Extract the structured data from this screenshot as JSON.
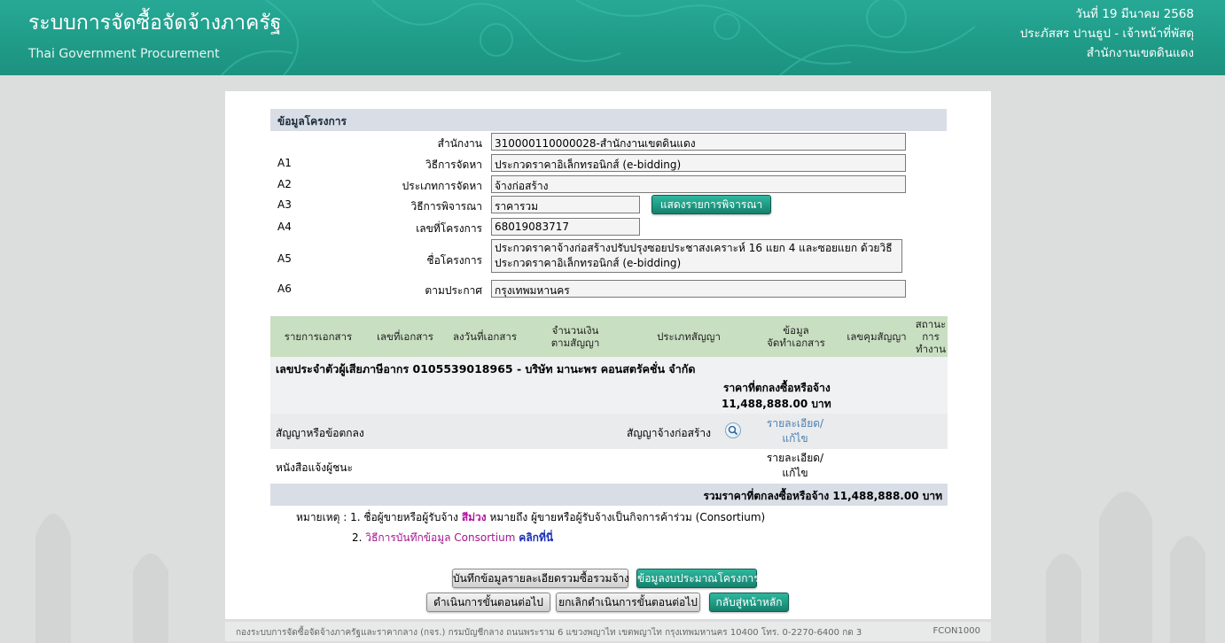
{
  "header": {
    "title": "ระบบการจัดซื้อจัดจ้างภาครัฐ",
    "subtitle": "Thai Government Procurement",
    "date": "วันที่ 19 มีนาคม 2568",
    "user": "ประภัสสร ปานธูป - เจ้าหน้าที่พัสดุ",
    "office": "สำนักงานเขตดินแดง"
  },
  "project": {
    "section_title": "ข้อมูลโครงการ",
    "rows": [
      {
        "code": "",
        "label": "สำนักงาน",
        "value": "310000110000028-สำนักงานเขตดินแดง"
      },
      {
        "code": "A1",
        "label": "วิธีการจัดหา",
        "value": "ประกวดราคาอิเล็กทรอนิกส์ (e-bidding)"
      },
      {
        "code": "A2",
        "label": "ประเภทการจัดหา",
        "value": "จ้างก่อสร้าง"
      },
      {
        "code": "A3",
        "label": "วิธีการพิจารณา",
        "value": "ราคารวม"
      },
      {
        "code": "A4",
        "label": "เลขที่โครงการ",
        "value": "68019083717"
      },
      {
        "code": "A5",
        "label": "ชื่อโครงการ",
        "value": "ประกวดราคาจ้างก่อสร้างปรับปรุงซอยประชาสงเคราะห์ 16 แยก 4 และซอยแยก ด้วยวิธีประกวดราคาอิเล็กทรอนิกส์ (e-bidding)"
      },
      {
        "code": "A6",
        "label": "ตามประกาศ",
        "value": "กรุงเทพมหานคร"
      }
    ],
    "show_items_button": "แสดงรายการพิจารณา"
  },
  "table": {
    "headers": {
      "doc_list": "รายการเอกสาร",
      "doc_no": "เลขที่เอกสาร",
      "doc_date": "ลงวันที่เอกสาร",
      "amount_1": "จำนวนเงิน",
      "amount_2": "ตามสัญญา",
      "contract_type": "ประเภทสัญญา",
      "info_1": "ข้อมูล",
      "info_2": "จัดทำเอกสาร",
      "control_no": "เลขคุมสัญญา",
      "status_1": "สถานะ",
      "status_2": "การ",
      "status_3": "ทำงาน"
    },
    "vendor": "เลขประจำตัวผู้เสียภาษีอากร 0105539018965 - บริษัท มานะพร คอนสตรัคชั่น จำกัด",
    "price_label": "ราคาที่ตกลงซื้อหรือจ้าง",
    "price_value": "11,488,888.00 บาท",
    "docs": [
      {
        "name": "สัญญาหรือข้อตกลง",
        "type": "สัญญาจ้างก่อสร้าง",
        "link_1": "รายละเอียด/",
        "link_2": "แก้ไข"
      },
      {
        "name": "หนังสือแจ้งผู้ชนะ",
        "type": "",
        "link_1": "รายละเอียด/",
        "link_2": "แก้ไข"
      }
    ],
    "total": "รวมราคาที่ตกลงซื้อหรือจ้าง 11,488,888.00 บาท"
  },
  "notes": {
    "prefix": "หมายเหตุ : 1. ชื่อผู้ขายหรือผู้รับจ้าง",
    "purple_word": "สีม่วง",
    "note1_rest": "หมายถึง ผู้ขายหรือผู้รับจ้างเป็นกิจการค้าร่วม (Consortium)",
    "note2_num": "2.",
    "note2_text": "วิธีการบันทึกข้อมูล Consortium",
    "note2_link": "คลิกที่นี่"
  },
  "buttons": {
    "save_detail": "บันทึกข้อมูลรายละเอียดรวมซื้อรวมจ้าง",
    "budget_info": "ข้อมูลงบประมาณโครงการ",
    "next_step": "ดำเนินการขั้นตอนต่อไป",
    "cancel_next": "ยกเลิกดำเนินการขั้นตอนต่อไป",
    "home": "กลับสู่หน้าหลัก"
  },
  "footer": {
    "left": "กองระบบการจัดซื้อจัดจ้างภาครัฐและราคากลาง (กจร.) กรมบัญชีกลาง ถนนพระราม 6 แขวงพญาไท เขตพญาไท กรุงเทพมหานคร 10400 โทร. 0-2270-6400 กด 3",
    "right": "FCON1000"
  },
  "colors": {
    "header_teal": "#1f9b88",
    "table_head_green": "#c9dfc1",
    "section_gray_blue": "#d8dde6",
    "button_green": "#15806c"
  }
}
